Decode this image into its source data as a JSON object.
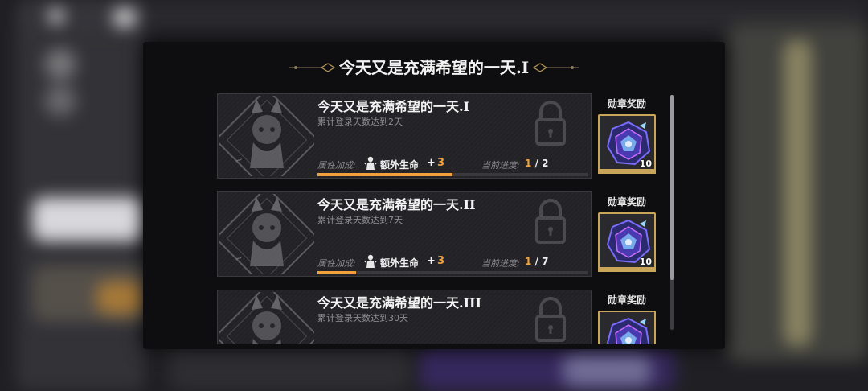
{
  "panel": {
    "title": "今天又是充满希望的一天.I"
  },
  "achievements": [
    {
      "name": "今天又是充满希望的一天.I",
      "description": "累计登录天数达到2天",
      "bonus_label": "属性加成:",
      "bonus_icon": "figure-icon",
      "bonus_name": "额外生命",
      "bonus_plus": "+",
      "bonus_value": "3",
      "progress_label": "当前进度:",
      "progress_current": "1",
      "progress_sep": "/",
      "progress_total": "2",
      "progress_fraction": 0.5,
      "reward_label": "勋章奖励",
      "reward_qty": "10"
    },
    {
      "name": "今天又是充满希望的一天.II",
      "description": "累计登录天数达到7天",
      "bonus_label": "属性加成:",
      "bonus_icon": "figure-icon",
      "bonus_name": "额外生命",
      "bonus_plus": "+",
      "bonus_value": "3",
      "progress_label": "当前进度:",
      "progress_current": "1",
      "progress_sep": "/",
      "progress_total": "7",
      "progress_fraction": 0.143,
      "reward_label": "勋章奖励",
      "reward_qty": "10"
    },
    {
      "name": "今天又是充满希望的一天.III",
      "description": "累计登录天数达到30天",
      "reward_label": "勋章奖励"
    }
  ],
  "colors": {
    "accent": "#f2a23a",
    "gold_frame": "#c9a55a",
    "panel_bg": "#0e0e10"
  },
  "icons": {
    "lock": "lock-icon",
    "medal": "medal-icon",
    "emblem": "cat-girl-emblem"
  }
}
